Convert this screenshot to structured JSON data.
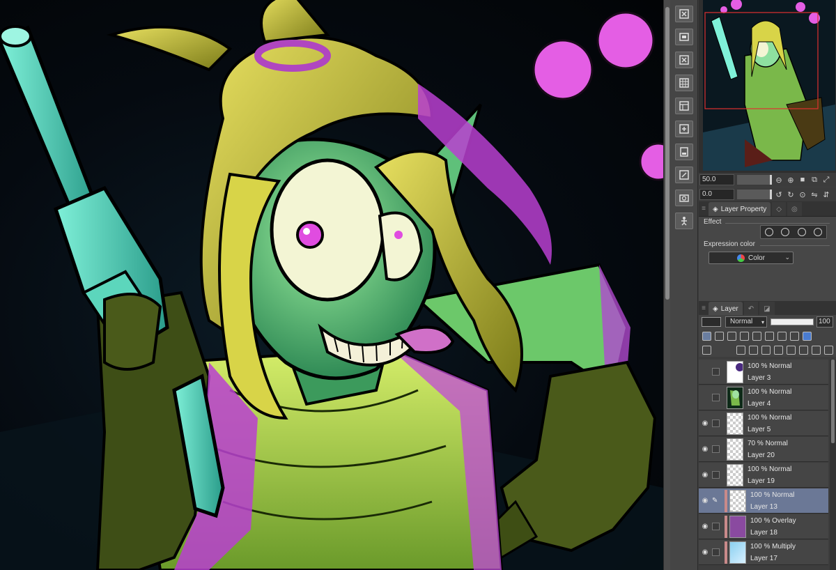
{
  "canvas": {
    "artwork": "illustration-canvas"
  },
  "tools": [
    {
      "icon": "copy-layer-icon"
    },
    {
      "icon": "export-icon"
    },
    {
      "icon": "delete-icon"
    },
    {
      "icon": "grid-icon"
    },
    {
      "icon": "ruler-icon"
    },
    {
      "icon": "transform-icon"
    },
    {
      "icon": "page-icon"
    },
    {
      "icon": "edit-icon"
    },
    {
      "icon": "camera-icon"
    },
    {
      "icon": "figure-icon"
    }
  ],
  "navigator": {
    "zoom_value": "50.0",
    "rotate_value": "0.0"
  },
  "layer_property": {
    "tab_label": "Layer Property",
    "effect_label": "Effect",
    "expression_label": "Expression color",
    "color_select": "Color"
  },
  "layer_panel": {
    "tab_label": "Layer",
    "blend_mode": "Normal",
    "opacity": "100",
    "layers": [
      {
        "mode": "100 % Normal",
        "name": "Layer 3",
        "visible": false,
        "selected": false
      },
      {
        "mode": "100 % Normal",
        "name": "Layer 4",
        "visible": false,
        "selected": false
      },
      {
        "mode": "100 % Normal",
        "name": "Layer 5",
        "visible": true,
        "selected": false
      },
      {
        "mode": "70 % Normal",
        "name": "Layer 20",
        "visible": true,
        "selected": false
      },
      {
        "mode": "100 % Normal",
        "name": "Layer 19",
        "visible": true,
        "selected": false
      },
      {
        "mode": "100 % Normal",
        "name": "Layer 13",
        "visible": true,
        "selected": true
      },
      {
        "mode": "100 % Overlay",
        "name": "Layer 18",
        "visible": true,
        "selected": false
      },
      {
        "mode": "100 % Multiply",
        "name": "Layer 17",
        "visible": true,
        "selected": false
      }
    ]
  },
  "colors": {
    "accent_magenta": "#e04ce0",
    "skin_green": "#6fd08a",
    "hair_yellow": "#c9c23a",
    "selected_row": "#6b7896"
  }
}
